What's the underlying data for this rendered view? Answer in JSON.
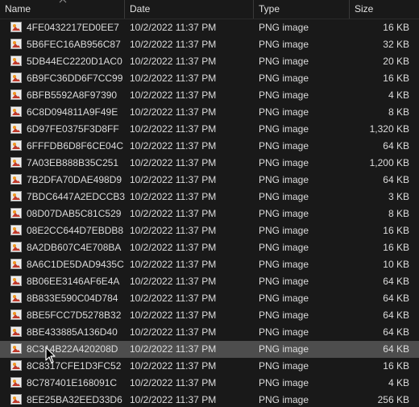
{
  "columns": {
    "name": "Name",
    "date": "Date",
    "type": "Type",
    "size": "Size"
  },
  "files": [
    {
      "name": "4FE0432217ED0EE7",
      "date": "10/2/2022 11:37 PM",
      "type": "PNG image",
      "size": "16 KB"
    },
    {
      "name": "5B6FEC16AB956C87",
      "date": "10/2/2022 11:37 PM",
      "type": "PNG image",
      "size": "32 KB"
    },
    {
      "name": "5DB44EC2220D1AC0",
      "date": "10/2/2022 11:37 PM",
      "type": "PNG image",
      "size": "20 KB"
    },
    {
      "name": "6B9FC36DD6F7CC99",
      "date": "10/2/2022 11:37 PM",
      "type": "PNG image",
      "size": "16 KB"
    },
    {
      "name": "6BFB5592A8F97390",
      "date": "10/2/2022 11:37 PM",
      "type": "PNG image",
      "size": "4 KB"
    },
    {
      "name": "6C8D094811A9F49E",
      "date": "10/2/2022 11:37 PM",
      "type": "PNG image",
      "size": "8 KB"
    },
    {
      "name": "6D97FE0375F3D8FF",
      "date": "10/2/2022 11:37 PM",
      "type": "PNG image",
      "size": "1,320 KB"
    },
    {
      "name": "6FFFDB6D8F6CE04C",
      "date": "10/2/2022 11:37 PM",
      "type": "PNG image",
      "size": "64 KB"
    },
    {
      "name": "7A03EB888B35C251",
      "date": "10/2/2022 11:37 PM",
      "type": "PNG image",
      "size": "1,200 KB"
    },
    {
      "name": "7B2DFA70DAE498D9",
      "date": "10/2/2022 11:37 PM",
      "type": "PNG image",
      "size": "64 KB"
    },
    {
      "name": "7BDC6447A2EDCCB3",
      "date": "10/2/2022 11:37 PM",
      "type": "PNG image",
      "size": "3 KB"
    },
    {
      "name": "08D07DAB5C81C529",
      "date": "10/2/2022 11:37 PM",
      "type": "PNG image",
      "size": "8 KB"
    },
    {
      "name": "08E2CC644D7EBDB8",
      "date": "10/2/2022 11:37 PM",
      "type": "PNG image",
      "size": "16 KB"
    },
    {
      "name": "8A2DB607C4E708BA",
      "date": "10/2/2022 11:37 PM",
      "type": "PNG image",
      "size": "16 KB"
    },
    {
      "name": "8A6C1DE5DAD9435C",
      "date": "10/2/2022 11:37 PM",
      "type": "PNG image",
      "size": "10 KB"
    },
    {
      "name": "8B06EE3146AF6E4A",
      "date": "10/2/2022 11:37 PM",
      "type": "PNG image",
      "size": "64 KB"
    },
    {
      "name": "8B833E590C04D784",
      "date": "10/2/2022 11:37 PM",
      "type": "PNG image",
      "size": "64 KB"
    },
    {
      "name": "8BE5FCC7D5278B32",
      "date": "10/2/2022 11:37 PM",
      "type": "PNG image",
      "size": "64 KB"
    },
    {
      "name": "8BE433885A136D40",
      "date": "10/2/2022 11:37 PM",
      "type": "PNG image",
      "size": "64 KB"
    },
    {
      "name": "8C314B22A420208D",
      "date": "10/2/2022 11:37 PM",
      "type": "PNG image",
      "size": "64 KB",
      "selected": true
    },
    {
      "name": "8C8317CFE1D3FC52",
      "date": "10/2/2022 11:37 PM",
      "type": "PNG image",
      "size": "16 KB"
    },
    {
      "name": "8C787401E168091C",
      "date": "10/2/2022 11:37 PM",
      "type": "PNG image",
      "size": "4 KB"
    },
    {
      "name": "8EE25BA32EED33D6",
      "date": "10/2/2022 11:37 PM",
      "type": "PNG image",
      "size": "256 KB"
    }
  ],
  "icons": {
    "sort": "sort-ascending-icon",
    "file": "png-image-file-icon",
    "cursor": "mouse-pointer-icon"
  },
  "colors": {
    "background": "#191919",
    "text": "#dcdcdc",
    "selected_row": "#4d4d4d",
    "icon_frame": "#d0d0d0",
    "icon_sun": "#f09820",
    "icon_land": "#c0392b"
  }
}
